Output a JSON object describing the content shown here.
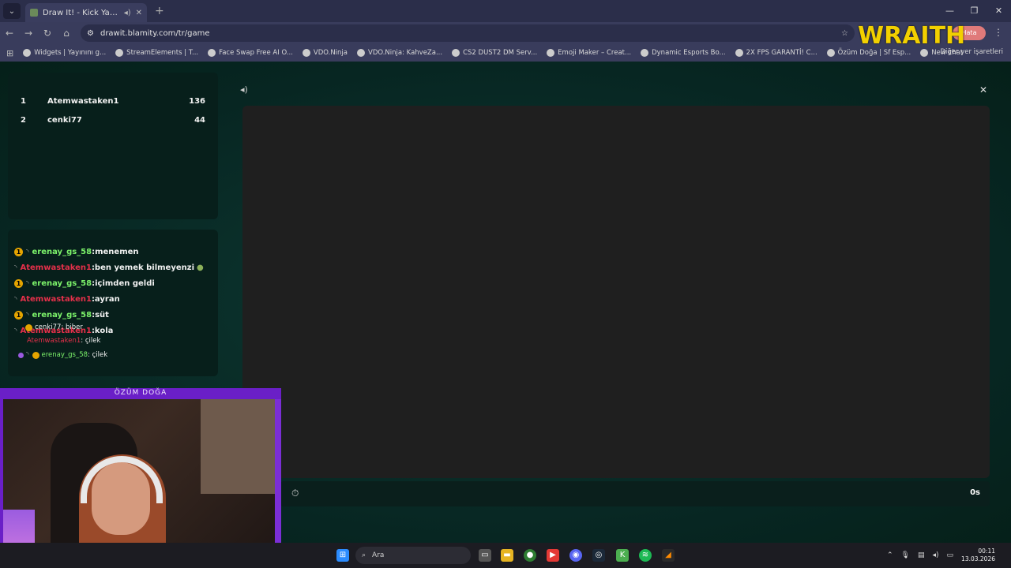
{
  "browser": {
    "tab_title": "Draw It! - Kick Yayınları İçin",
    "url": "drawit.blamity.com/tr/game",
    "profile_label": "Hata",
    "bookmarks": [
      "Widgets | Yayınını g...",
      "StreamElements | T...",
      "Face Swap Free AI O...",
      "VDO.Ninja",
      "VDO.Ninja: KahveZa...",
      "CS2 DUST2 DM Serv...",
      "Emoji Maker – Creat...",
      "Dynamic Esports Bo...",
      "2X FPS GARANTİ! C...",
      "Özüm Doğa | Sf Esp...",
      "New chat"
    ],
    "bookmarks_end": "Diğer yer işaretleri"
  },
  "overlay": {
    "brand": "WRAITH",
    "cam_label": "ÖZÜM DOĞA"
  },
  "leaderboard": [
    {
      "rank": "1",
      "name": "Atemwastaken1",
      "score": "136"
    },
    {
      "rank": "2",
      "name": "cenki77",
      "score": "44"
    }
  ],
  "chat": [
    {
      "badge": true,
      "user": "erenay_gs_58",
      "color": "green",
      "text": ":menemen"
    },
    {
      "badge": false,
      "user": "Atemwastaken1",
      "color": "red",
      "text": ":ben yemek bilmeyenzi"
    },
    {
      "badge": true,
      "user": "erenay_gs_58",
      "color": "green",
      "text": ":içimden geldi"
    },
    {
      "badge": false,
      "user": "Atemwastaken1",
      "color": "red",
      "text": ":ayran"
    },
    {
      "badge": true,
      "user": "erenay_gs_58",
      "color": "green",
      "text": ":süt"
    },
    {
      "badge": false,
      "user": "Atemwastaken1",
      "color": "red",
      "text": ":kola"
    }
  ],
  "overlay_chat": [
    {
      "user": "cenki77",
      "text": " : biber"
    },
    {
      "user": "Atemwastaken1",
      "text": " : çilek"
    },
    {
      "user": "erenay_gs_58",
      "text": " : çilek"
    }
  ],
  "game": {
    "timer": "0s"
  },
  "taskbar": {
    "search_placeholder": "Ara",
    "time": "00:11",
    "date": "13.03.2026"
  }
}
